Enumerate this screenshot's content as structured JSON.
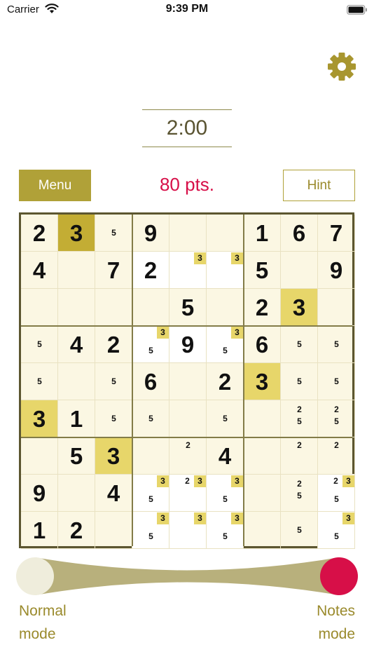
{
  "status": {
    "carrier": "Carrier",
    "time": "9:39 PM"
  },
  "timer": "2:00",
  "menu_label": "Menu",
  "score": "80 pts.",
  "hint_label": "Hint",
  "modes": {
    "normal": "Normal mode",
    "notes": "Notes mode",
    "active": "notes"
  },
  "colors": {
    "accent": "#b0a138",
    "score": "#d70f48",
    "highlight": "#e7d66a",
    "selected": "#c3ad34",
    "notes_knob": "#d70f48",
    "normal_knob": "#efeddc"
  },
  "icons": {
    "settings": "gear-icon",
    "wifi": "wifi-icon",
    "battery": "battery-icon"
  },
  "board": [
    [
      {
        "v": "2"
      },
      {
        "v": "3",
        "sel": true
      },
      {
        "notes": [
          "5"
        ]
      },
      {
        "v": "9"
      },
      {},
      {},
      {
        "v": "1"
      },
      {
        "v": "6"
      },
      {
        "v": "7"
      }
    ],
    [
      {
        "v": "4"
      },
      {},
      {
        "v": "7"
      },
      {
        "v": "2",
        "white": true
      },
      {
        "white": true,
        "notes": [
          "3h"
        ]
      },
      {
        "white": true,
        "notes": [
          "3h"
        ]
      },
      {
        "v": "5"
      },
      {},
      {
        "v": "9"
      }
    ],
    [
      {},
      {},
      {},
      {},
      {
        "v": "5"
      },
      {},
      {
        "v": "2"
      },
      {
        "v": "3",
        "hl": true
      },
      {}
    ],
    [
      {
        "notes": [
          "5"
        ]
      },
      {
        "v": "4"
      },
      {
        "v": "2"
      },
      {
        "white": true,
        "notes": [
          "3h",
          "5"
        ]
      },
      {
        "v": "9",
        "white": true
      },
      {
        "white": true,
        "notes": [
          "3h",
          "5"
        ]
      },
      {
        "v": "6"
      },
      {
        "notes": [
          "5"
        ]
      },
      {
        "notes": [
          "5"
        ]
      }
    ],
    [
      {
        "notes": [
          "5"
        ]
      },
      {},
      {
        "notes": [
          "5"
        ]
      },
      {
        "v": "6"
      },
      {},
      {
        "v": "2"
      },
      {
        "v": "3",
        "hl": true
      },
      {
        "notes": [
          "5"
        ]
      },
      {
        "notes": [
          "5"
        ]
      }
    ],
    [
      {
        "v": "3",
        "hl": true
      },
      {
        "v": "1"
      },
      {
        "notes": [
          "5"
        ]
      },
      {
        "notes": [
          "5"
        ]
      },
      {},
      {
        "notes": [
          "5"
        ]
      },
      {},
      {
        "notes": [
          "2",
          "5"
        ]
      },
      {
        "notes": [
          "2",
          "5"
        ]
      }
    ],
    [
      {},
      {
        "v": "5"
      },
      {
        "v": "3",
        "hl": true
      },
      {},
      {
        "notes": [
          "2"
        ]
      },
      {
        "v": "4"
      },
      {},
      {
        "notes": [
          "2"
        ]
      },
      {
        "notes": [
          "2"
        ]
      }
    ],
    [
      {
        "v": "9"
      },
      {},
      {
        "v": "4"
      },
      {
        "white": true,
        "notes": [
          "3h",
          "5"
        ]
      },
      {
        "white": true,
        "notes": [
          "2",
          "3h"
        ]
      },
      {
        "white": true,
        "notes": [
          "3h",
          "5"
        ]
      },
      {},
      {
        "notes": [
          "2",
          "5"
        ]
      },
      {
        "white": true,
        "notes": [
          "2",
          "3h",
          "5"
        ]
      }
    ],
    [
      {
        "v": "1"
      },
      {
        "v": "2"
      },
      {},
      {
        "white": true,
        "notes": [
          "3h",
          "5"
        ]
      },
      {
        "white": true,
        "notes": [
          "3h"
        ]
      },
      {
        "white": true,
        "notes": [
          "3h",
          "5"
        ]
      },
      {},
      {
        "notes": [
          "5"
        ]
      },
      {
        "white": true,
        "notes": [
          "3h",
          "5"
        ]
      }
    ]
  ]
}
